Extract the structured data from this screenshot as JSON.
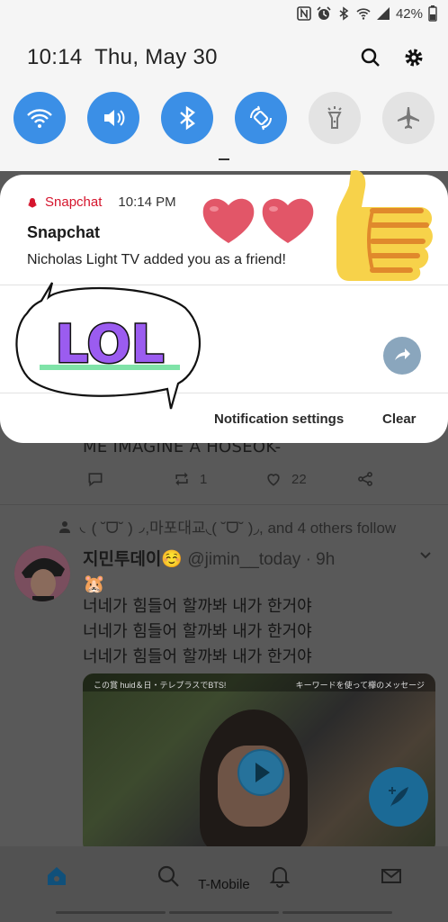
{
  "status_bar": {
    "battery": "42%",
    "icons": [
      "nfc-icon",
      "alarm-icon",
      "bluetooth-icon",
      "wifi-icon",
      "signal-icon",
      "battery-icon"
    ]
  },
  "quick_panel": {
    "time": "10:14",
    "date": "Thu, May 30",
    "tiles": [
      {
        "name": "wifi",
        "state": "on"
      },
      {
        "name": "sound",
        "state": "on"
      },
      {
        "name": "bluetooth",
        "state": "on"
      },
      {
        "name": "auto-rotate",
        "state": "on"
      },
      {
        "name": "flashlight",
        "state": "off"
      },
      {
        "name": "airplane-mode",
        "state": "off"
      }
    ],
    "accent": "#3b8fe6"
  },
  "notification": {
    "app": "Snapchat",
    "time": "10:14 PM",
    "title": "Snapchat",
    "body": "Nicholas Light TV added you as a friend!",
    "actions": {
      "settings": "Notification settings",
      "clear": "Clear"
    },
    "app_color": "#d5152d"
  },
  "stickers": {
    "lol_text": "LOL"
  },
  "feed": {
    "previous_tweet_tail": "ME IMAGINE A HOSEOK-",
    "previous_actions": {
      "retweets": "1",
      "likes": "22"
    },
    "social_context": "◟( ˘ᗜ˘ )◞,마포대교◟( ˘ᗜ˘ )◞, and 4 others follow",
    "tweet": {
      "name": "지민투데이☺️",
      "handle": "@jimin__today · 9h",
      "emoji": "🐹",
      "lines": [
        "너네가 힘들어 할까봐 내가 한거야",
        "너네가 힘들어 할까봐 내가 한거야",
        "너네가 힘들어 할까봐 내가 한거야"
      ],
      "media_caption_left": "この賞 huid＆日・テレプラスでBTS!",
      "media_caption_right": "キーワードを使って欅のメッセージ"
    }
  },
  "bottom_bar": {
    "carrier": "T-Mobile"
  }
}
